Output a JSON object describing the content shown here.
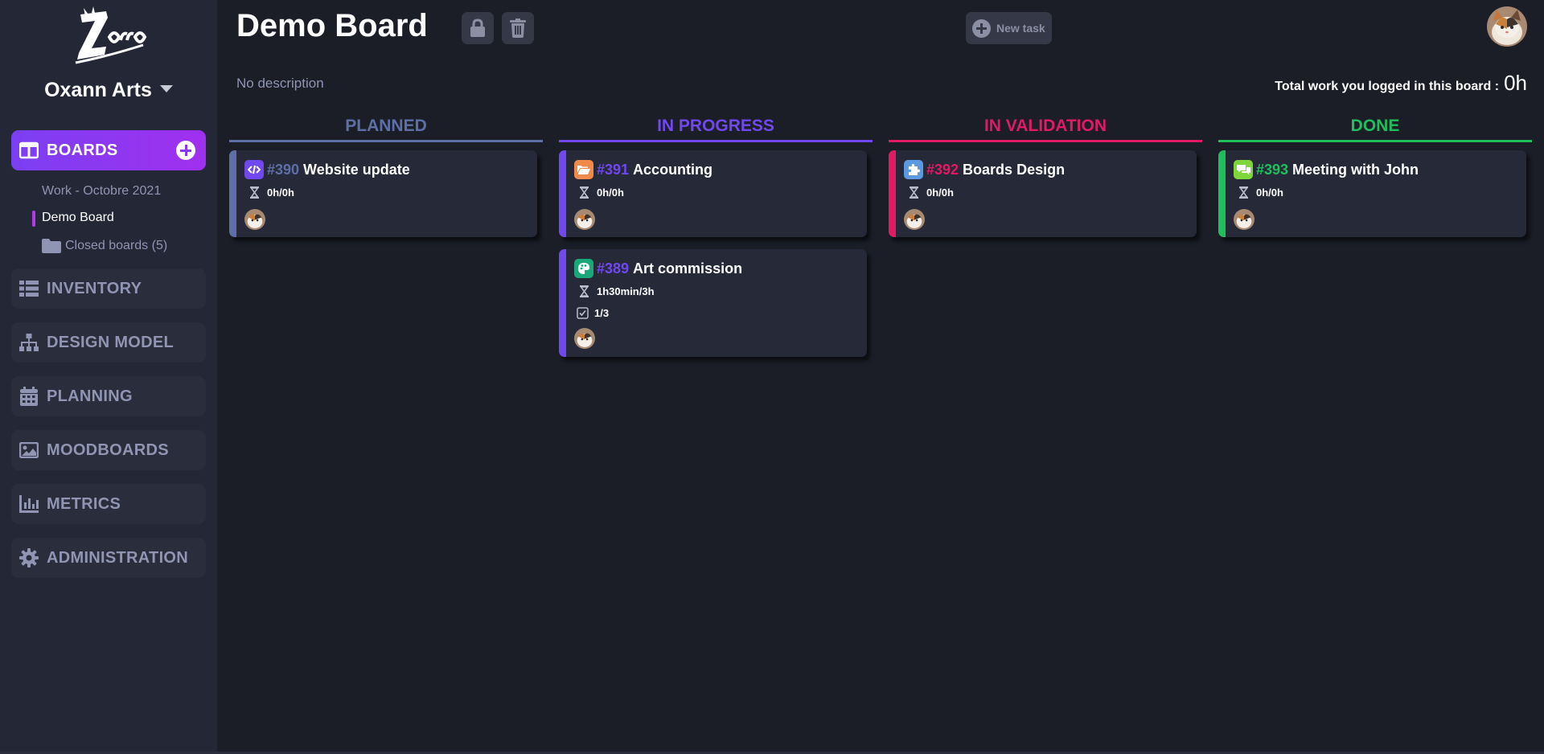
{
  "app": {
    "brand": "Zorro"
  },
  "sidebar": {
    "workspace": "Oxann Arts",
    "boards_label": "BOARDS",
    "sub_items": [
      "Work - Octobre 2021",
      "Demo Board"
    ],
    "closed_boards": "Closed boards (5)",
    "nav": [
      {
        "label": "INVENTORY",
        "icon": "list-icon"
      },
      {
        "label": "DESIGN MODEL",
        "icon": "sitemap-icon"
      },
      {
        "label": "PLANNING",
        "icon": "calendar-icon"
      },
      {
        "label": "MOODBOARDS",
        "icon": "image-icon"
      },
      {
        "label": "METRICS",
        "icon": "chart-icon"
      },
      {
        "label": "ADMINISTRATION",
        "icon": "gear-icon"
      }
    ]
  },
  "header": {
    "title": "Demo Board",
    "new_task": "New task",
    "description": "No description",
    "total_label": "Total work you logged in this board :",
    "total_value": "0h"
  },
  "columns": [
    {
      "title": "PLANNED",
      "color": "#5e6fa8"
    },
    {
      "title": "IN PROGRESS",
      "color": "#7148f0"
    },
    {
      "title": "IN VALIDATION",
      "color": "#e01b63"
    },
    {
      "title": "DONE",
      "color": "#1fbf5c"
    }
  ],
  "cards": [
    {
      "id": "#390",
      "title": "Website update",
      "time": "0h/0h",
      "icon": "code-icon"
    },
    {
      "id": "#391",
      "title": "Accounting",
      "time": "0h/0h",
      "icon": "folder-open-icon"
    },
    {
      "id": "#389",
      "title": "Art commission",
      "time": "1h30min/3h",
      "checklist": "1/3",
      "icon": "palette-icon"
    },
    {
      "id": "#392",
      "title": "Boards Design",
      "time": "0h/0h",
      "icon": "puzzle-icon"
    },
    {
      "id": "#393",
      "title": "Meeting with John",
      "time": "0h/0h",
      "icon": "chat-icon"
    }
  ]
}
